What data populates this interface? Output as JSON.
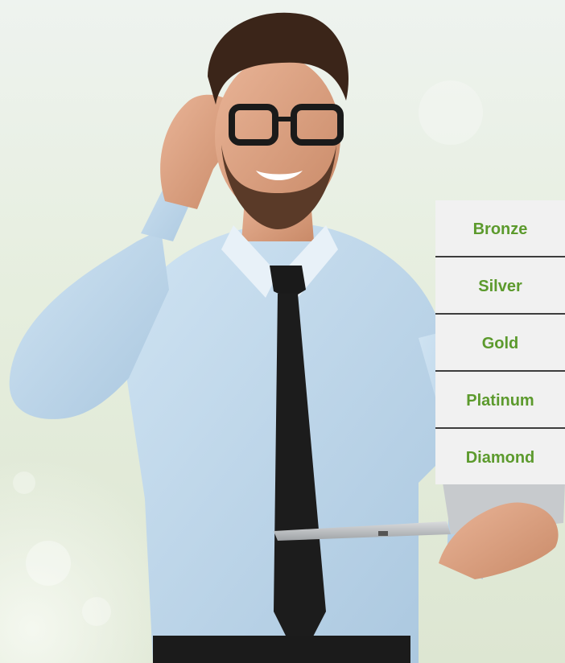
{
  "tiers": [
    {
      "label": "Bronze"
    },
    {
      "label": "Silver"
    },
    {
      "label": "Gold"
    },
    {
      "label": "Platinum"
    },
    {
      "label": "Diamond"
    }
  ],
  "colors": {
    "tier_label": "#5c9a2d",
    "tier_background": "#f1f1f1",
    "tier_divider": "#3d3d3d"
  },
  "hero_image": {
    "icon": "businessman-with-laptop-photo"
  }
}
